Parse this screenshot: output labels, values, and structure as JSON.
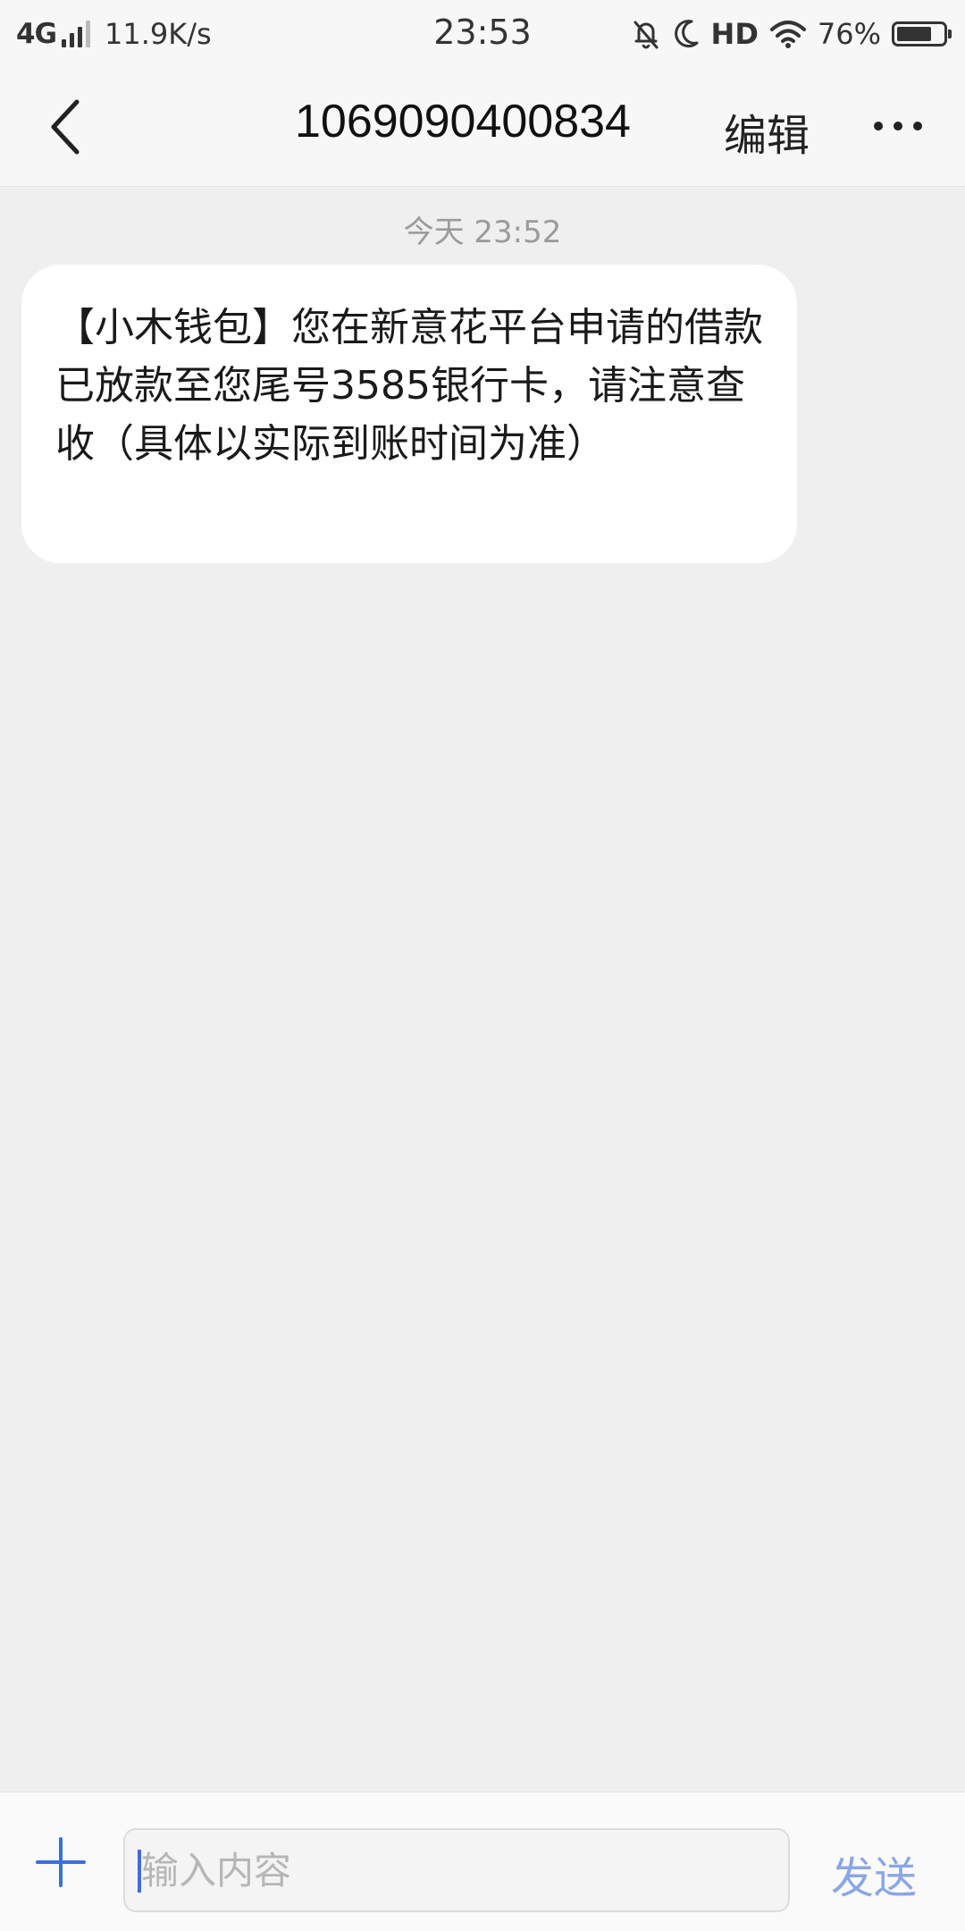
{
  "status_bar": {
    "network": "4G",
    "speed": "11.9K/s",
    "time": "23:53",
    "hd": "HD",
    "battery_text": "76%",
    "battery_level": 0.76,
    "icons": [
      "signal-icon",
      "mute-bell-icon",
      "moon-icon",
      "wifi-icon",
      "battery-icon"
    ]
  },
  "nav": {
    "title": "1069090400834",
    "edit_label": "编辑",
    "icons": [
      "back-chevron-icon",
      "more-dots-icon"
    ]
  },
  "conversation": {
    "date_label": "今天 23:52",
    "messages": [
      {
        "text": "【小木钱包】您在新意花平台申请的借款已放款至您尾号3585银行卡，请注意查收（具体以实际到账时间为准）"
      }
    ]
  },
  "input_bar": {
    "placeholder": "输入内容",
    "value": "",
    "send_label": "发送",
    "icons": [
      "plus-icon"
    ]
  },
  "colors": {
    "accent": "#3b6fe0",
    "send_disabled": "#8aa6e6",
    "background": "#efefef",
    "bar": "#f7f7f7",
    "bubble": "#ffffff"
  }
}
